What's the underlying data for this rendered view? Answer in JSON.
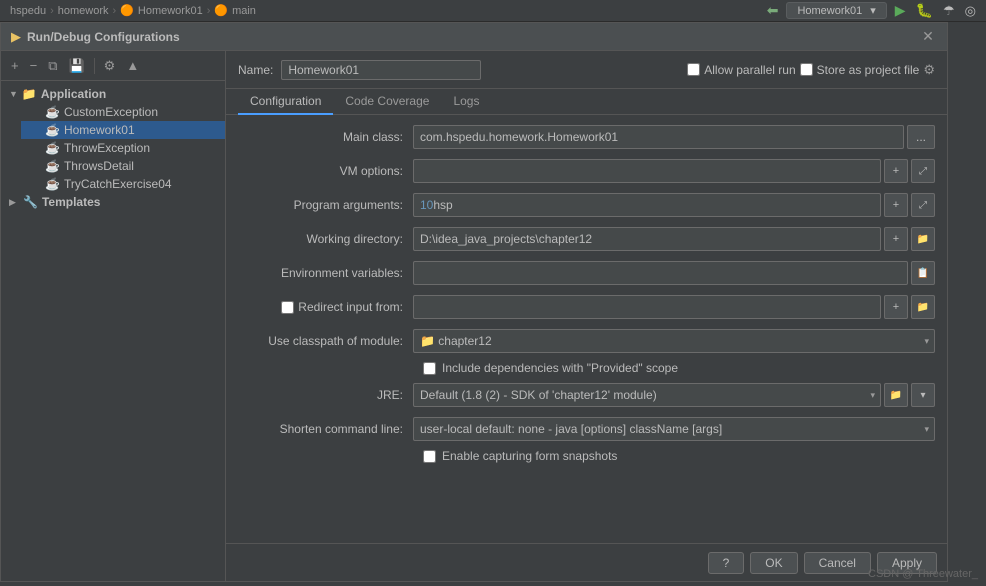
{
  "topbar": {
    "breadcrumb": [
      "hspedu",
      "homework",
      "Homework01",
      "main"
    ],
    "run_config_label": "Homework01",
    "chevron": "▾"
  },
  "dialog": {
    "title": "Run/Debug Configurations",
    "title_icon": "▶",
    "close_icon": "✕"
  },
  "toolbar": {
    "add_icon": "+",
    "minus_icon": "−",
    "copy_icon": "⧉",
    "save_icon": "💾",
    "settings_icon": "⚙",
    "up_icon": "▲",
    "separator": "|"
  },
  "tree": {
    "application_label": "Application",
    "application_expanded": true,
    "items": [
      {
        "label": "CustomException",
        "icon": "☕"
      },
      {
        "label": "Homework01",
        "icon": "☕",
        "selected": true
      },
      {
        "label": "ThrowException",
        "icon": "☕"
      },
      {
        "label": "ThrowsDetail",
        "icon": "☕"
      },
      {
        "label": "TryCatchExercise04",
        "icon": "☕"
      }
    ],
    "templates_label": "Templates",
    "templates_icon": "🔧"
  },
  "form": {
    "name_label": "Name:",
    "name_value": "Homework01",
    "allow_parallel_run_label": "Allow parallel run",
    "store_as_project_label": "Store as project file",
    "tabs": [
      "Configuration",
      "Code Coverage",
      "Logs"
    ],
    "active_tab": "Configuration",
    "fields": {
      "main_class_label": "Main class:",
      "main_class_value": "com.hspedu.homework.Homework01",
      "vm_options_label": "VM options:",
      "vm_options_value": "",
      "program_args_label": "Program arguments:",
      "program_args_num": "10",
      "program_args_str": "  hsp",
      "working_dir_label": "Working directory:",
      "working_dir_value": "D:\\idea_java_projects\\chapter12",
      "env_vars_label": "Environment variables:",
      "redirect_input_label": "Redirect input from:",
      "classpath_label": "Use classpath of module:",
      "classpath_value": "chapter12",
      "include_deps_label": "Include dependencies with \"Provided\" scope",
      "jre_label": "JRE:",
      "jre_value": "Default",
      "jre_detail": "(1.8 (2) - SDK of 'chapter12' module)",
      "shorten_cmd_label": "Shorten command line:",
      "shorten_cmd_value": "user-local default: none",
      "shorten_cmd_detail": " - java [options] className [args]",
      "capturing_label": "Enable capturing form snapshots"
    }
  },
  "watermark": "CSDN @ Threewater_"
}
